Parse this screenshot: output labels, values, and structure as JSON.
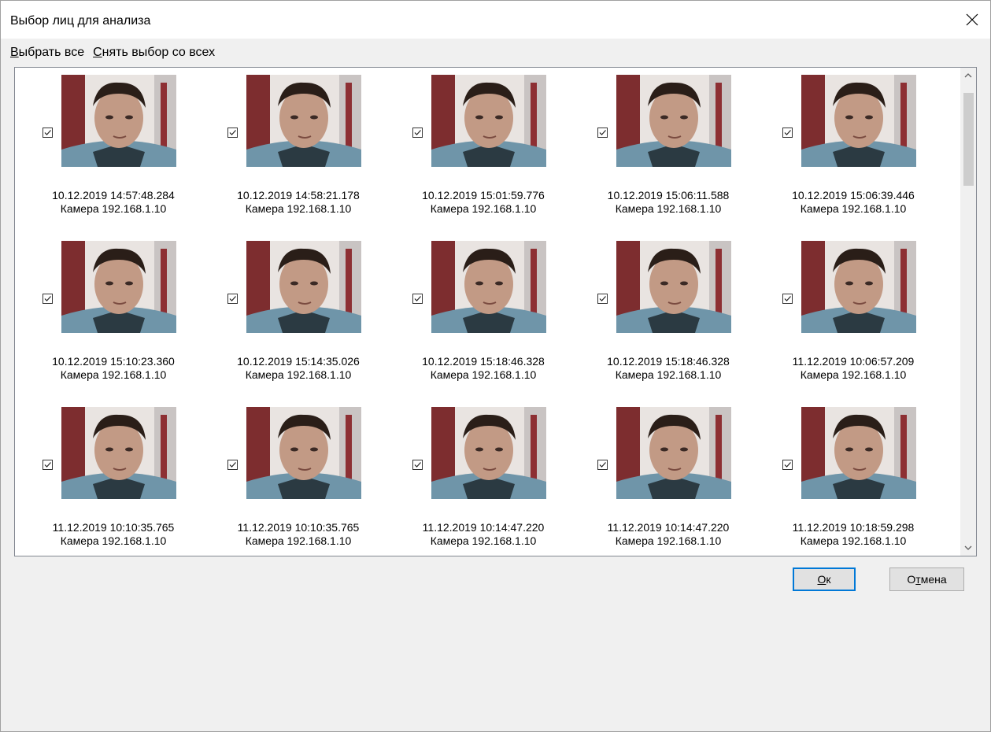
{
  "window": {
    "title": "Выбор лиц для анализа"
  },
  "toolbar": {
    "select_all_first": "В",
    "select_all_rest": "ыбрать все",
    "deselect_all_first": "С",
    "deselect_all_rest": "нять выбор со всех"
  },
  "faces": [
    {
      "timestamp": "10.12.2019 14:57:48.284",
      "camera": "Камера 192.168.1.10",
      "checked": true
    },
    {
      "timestamp": "10.12.2019 14:58:21.178",
      "camera": "Камера 192.168.1.10",
      "checked": true
    },
    {
      "timestamp": "10.12.2019 15:01:59.776",
      "camera": "Камера 192.168.1.10",
      "checked": true
    },
    {
      "timestamp": "10.12.2019 15:06:11.588",
      "camera": "Камера 192.168.1.10",
      "checked": true
    },
    {
      "timestamp": "10.12.2019 15:06:39.446",
      "camera": "Камера 192.168.1.10",
      "checked": true
    },
    {
      "timestamp": "10.12.2019 15:10:23.360",
      "camera": "Камера 192.168.1.10",
      "checked": true
    },
    {
      "timestamp": "10.12.2019 15:14:35.026",
      "camera": "Камера 192.168.1.10",
      "checked": true
    },
    {
      "timestamp": "10.12.2019 15:18:46.328",
      "camera": "Камера 192.168.1.10",
      "checked": true
    },
    {
      "timestamp": "10.12.2019 15:18:46.328",
      "camera": "Камера 192.168.1.10",
      "checked": true
    },
    {
      "timestamp": "11.12.2019 10:06:57.209",
      "camera": "Камера 192.168.1.10",
      "checked": true
    },
    {
      "timestamp": "11.12.2019 10:10:35.765",
      "camera": "Камера 192.168.1.10",
      "checked": true
    },
    {
      "timestamp": "11.12.2019 10:10:35.765",
      "camera": "Камера 192.168.1.10",
      "checked": true
    },
    {
      "timestamp": "11.12.2019 10:14:47.220",
      "camera": "Камера 192.168.1.10",
      "checked": true
    },
    {
      "timestamp": "11.12.2019 10:14:47.220",
      "camera": "Камера 192.168.1.10",
      "checked": true
    },
    {
      "timestamp": "11.12.2019 10:18:59.298",
      "camera": "Камера 192.168.1.10",
      "checked": true
    },
    {
      "timestamp": "",
      "camera": "",
      "checked": true
    },
    {
      "timestamp": "",
      "camera": "",
      "checked": true
    },
    {
      "timestamp": "",
      "camera": "",
      "checked": true
    },
    {
      "timestamp": "",
      "camera": "",
      "checked": true
    },
    {
      "timestamp": "",
      "camera": "",
      "checked": true
    }
  ],
  "buttons": {
    "ok_first": "О",
    "ok_rest": "к",
    "cancel_first": "О",
    "cancel_mid": "т",
    "cancel_rest": "мена"
  },
  "icons": {
    "close": "close-icon",
    "checkbox": "checkmark-icon",
    "scroll_up": "chevron-up-icon",
    "scroll_down": "chevron-down-icon"
  },
  "colors": {
    "accent": "#0078d7",
    "panel_border": "#828790",
    "button_face": "#e1e1e1"
  }
}
